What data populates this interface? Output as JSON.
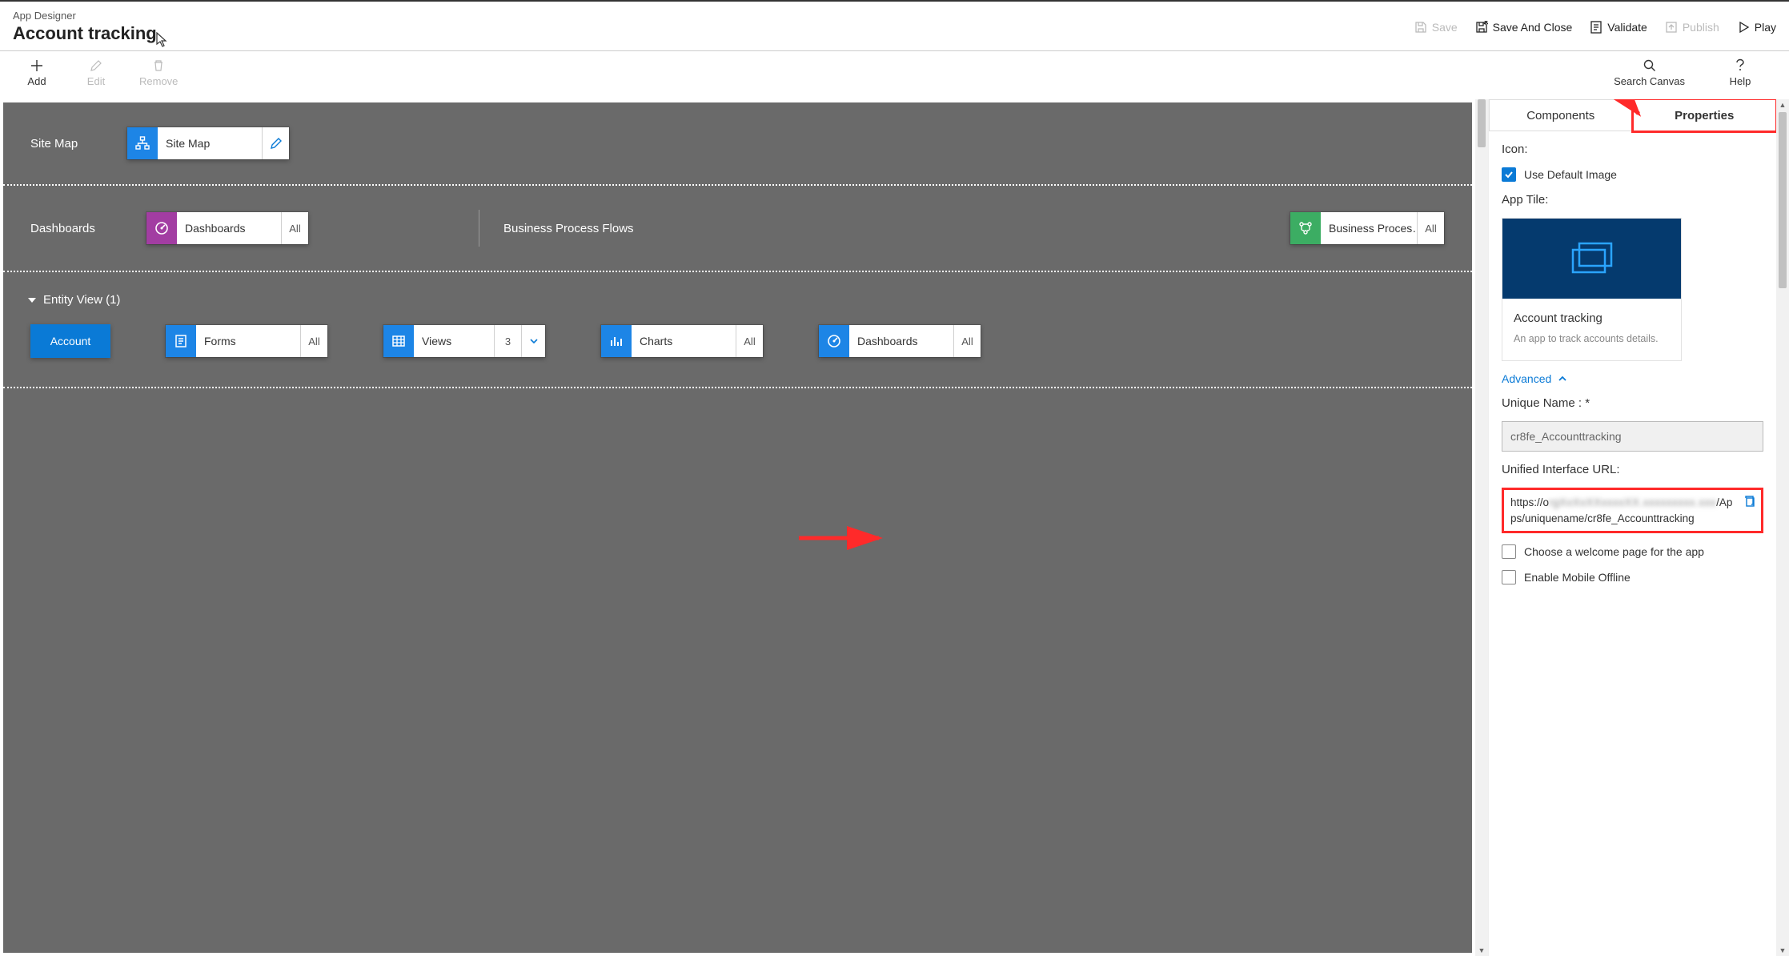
{
  "header": {
    "breadcrumb": "App Designer",
    "app_title": "Account tracking",
    "save": "Save",
    "save_close": "Save And Close",
    "validate": "Validate",
    "publish": "Publish",
    "play": "Play"
  },
  "toolbar": {
    "add": "Add",
    "edit": "Edit",
    "remove": "Remove",
    "search": "Search Canvas",
    "help": "Help"
  },
  "canvas": {
    "site_map_label": "Site Map",
    "site_map_tile": "Site Map",
    "dashboards_label": "Dashboards",
    "dashboards_tile": "Dashboards",
    "dashboards_badge": "All",
    "bpf_label": "Business Process Flows",
    "bpf_tile": "Business Proces…",
    "bpf_badge": "All",
    "entity_header": "Entity View (1)",
    "entity_pill": "Account",
    "forms_tile": "Forms",
    "forms_badge": "All",
    "views_tile": "Views",
    "views_badge": "3",
    "charts_tile": "Charts",
    "charts_badge": "All",
    "dash2_tile": "Dashboards",
    "dash2_badge": "All"
  },
  "panel": {
    "tab_components": "Components",
    "tab_properties": "Properties",
    "icon_label": "Icon:",
    "use_default": "Use Default Image",
    "app_tile_label": "App Tile:",
    "tile_title": "Account tracking",
    "tile_desc": "An app to track accounts details.",
    "advanced": "Advanced",
    "unique_name_label": "Unique Name : *",
    "unique_name_value": "cr8fe_Accounttracking",
    "url_label": "Unified Interface URL:",
    "url_prefix": "https://o",
    "url_blur": "rgXxXxXXxxxxXX.xxxxxxxxx.xxx",
    "url_suffix": "/Apps/uniquename/cr8fe_Accounttracking",
    "welcome_page": "Choose a welcome page for the app",
    "mobile_offline": "Enable Mobile Offline"
  }
}
